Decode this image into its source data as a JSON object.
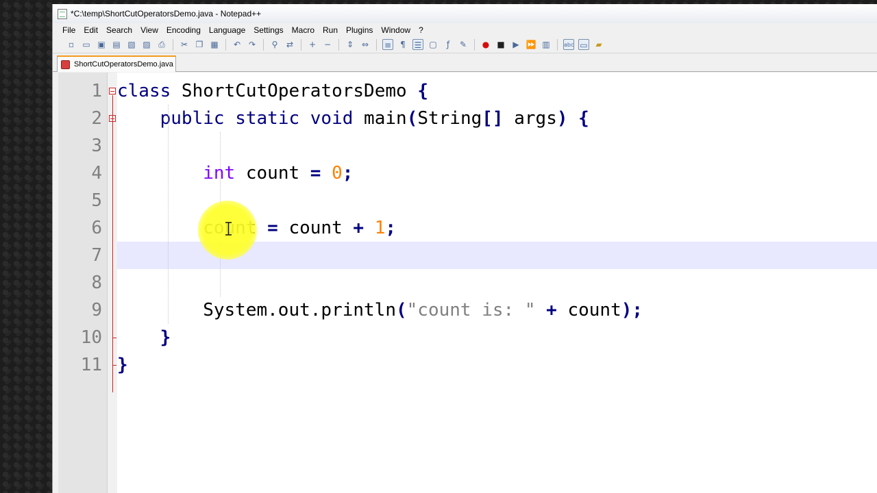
{
  "window": {
    "title": "*C:\\temp\\ShortCutOperatorsDemo.java - Notepad++"
  },
  "menu": [
    "File",
    "Edit",
    "Search",
    "View",
    "Encoding",
    "Language",
    "Settings",
    "Macro",
    "Run",
    "Plugins",
    "Window",
    "?"
  ],
  "tab": {
    "label": "ShortCutOperatorsDemo.java"
  },
  "toolbar": {
    "buttons": [
      "new-file",
      "open-file",
      "save",
      "save-all",
      "close",
      "close-all",
      "print",
      "cut",
      "copy",
      "paste",
      "undo",
      "redo",
      "find",
      "replace",
      "zoom-in",
      "zoom-out",
      "sync-vertical",
      "sync-horizontal",
      "word-wrap",
      "show-all-characters",
      "indent-guide",
      "user-defined-language",
      "function-list",
      "document-map",
      "record-macro",
      "stop-recording",
      "playback-macro",
      "run-macro-multiple",
      "save-macro",
      "spell-check",
      "column-mode",
      "folder-workspace"
    ]
  },
  "editor": {
    "line_numbers": [
      "1",
      "2",
      "3",
      "4",
      "5",
      "6",
      "7",
      "8",
      "9",
      "10",
      "11"
    ],
    "caret_line": 7,
    "lines": [
      [
        [
          "kw",
          "class"
        ],
        [
          "",
          " ShortCutOperatorsDemo "
        ],
        [
          "op",
          "{"
        ]
      ],
      [
        [
          "",
          "    "
        ],
        [
          "kw",
          "public"
        ],
        [
          "",
          " "
        ],
        [
          "kw",
          "static"
        ],
        [
          "",
          " "
        ],
        [
          "kw",
          "void"
        ],
        [
          "",
          " main"
        ],
        [
          "op",
          "("
        ],
        [
          "",
          "String"
        ],
        [
          "op",
          "[]"
        ],
        [
          "",
          " args"
        ],
        [
          "op",
          ")"
        ],
        [
          "",
          " "
        ],
        [
          "op",
          "{"
        ]
      ],
      [],
      [
        [
          "",
          "        "
        ],
        [
          "ty",
          "int"
        ],
        [
          "",
          " count "
        ],
        [
          "op",
          "="
        ],
        [
          "",
          " "
        ],
        [
          "num",
          "0"
        ],
        [
          "op",
          ";"
        ]
      ],
      [],
      [
        [
          "",
          "        count "
        ],
        [
          "op",
          "="
        ],
        [
          "",
          " count "
        ],
        [
          "op",
          "+"
        ],
        [
          "",
          " "
        ],
        [
          "num",
          "1"
        ],
        [
          "op",
          ";"
        ]
      ],
      [],
      [],
      [
        [
          "",
          "        System.out.println"
        ],
        [
          "op",
          "("
        ],
        [
          "str",
          "\"count is: \""
        ],
        [
          "",
          " "
        ],
        [
          "op",
          "+"
        ],
        [
          "",
          " count"
        ],
        [
          "op",
          ")"
        ],
        [
          "op",
          ";"
        ]
      ],
      [
        [
          "",
          "    "
        ],
        [
          "op",
          "}"
        ]
      ],
      [
        [
          "op",
          "}"
        ]
      ]
    ]
  },
  "colors": {
    "keyword": "#000080",
    "type": "#8000ff",
    "number": "#ff8000",
    "string": "#808080",
    "caret_line": "#e8e8ff",
    "tab_accent": "#f29c1c"
  }
}
